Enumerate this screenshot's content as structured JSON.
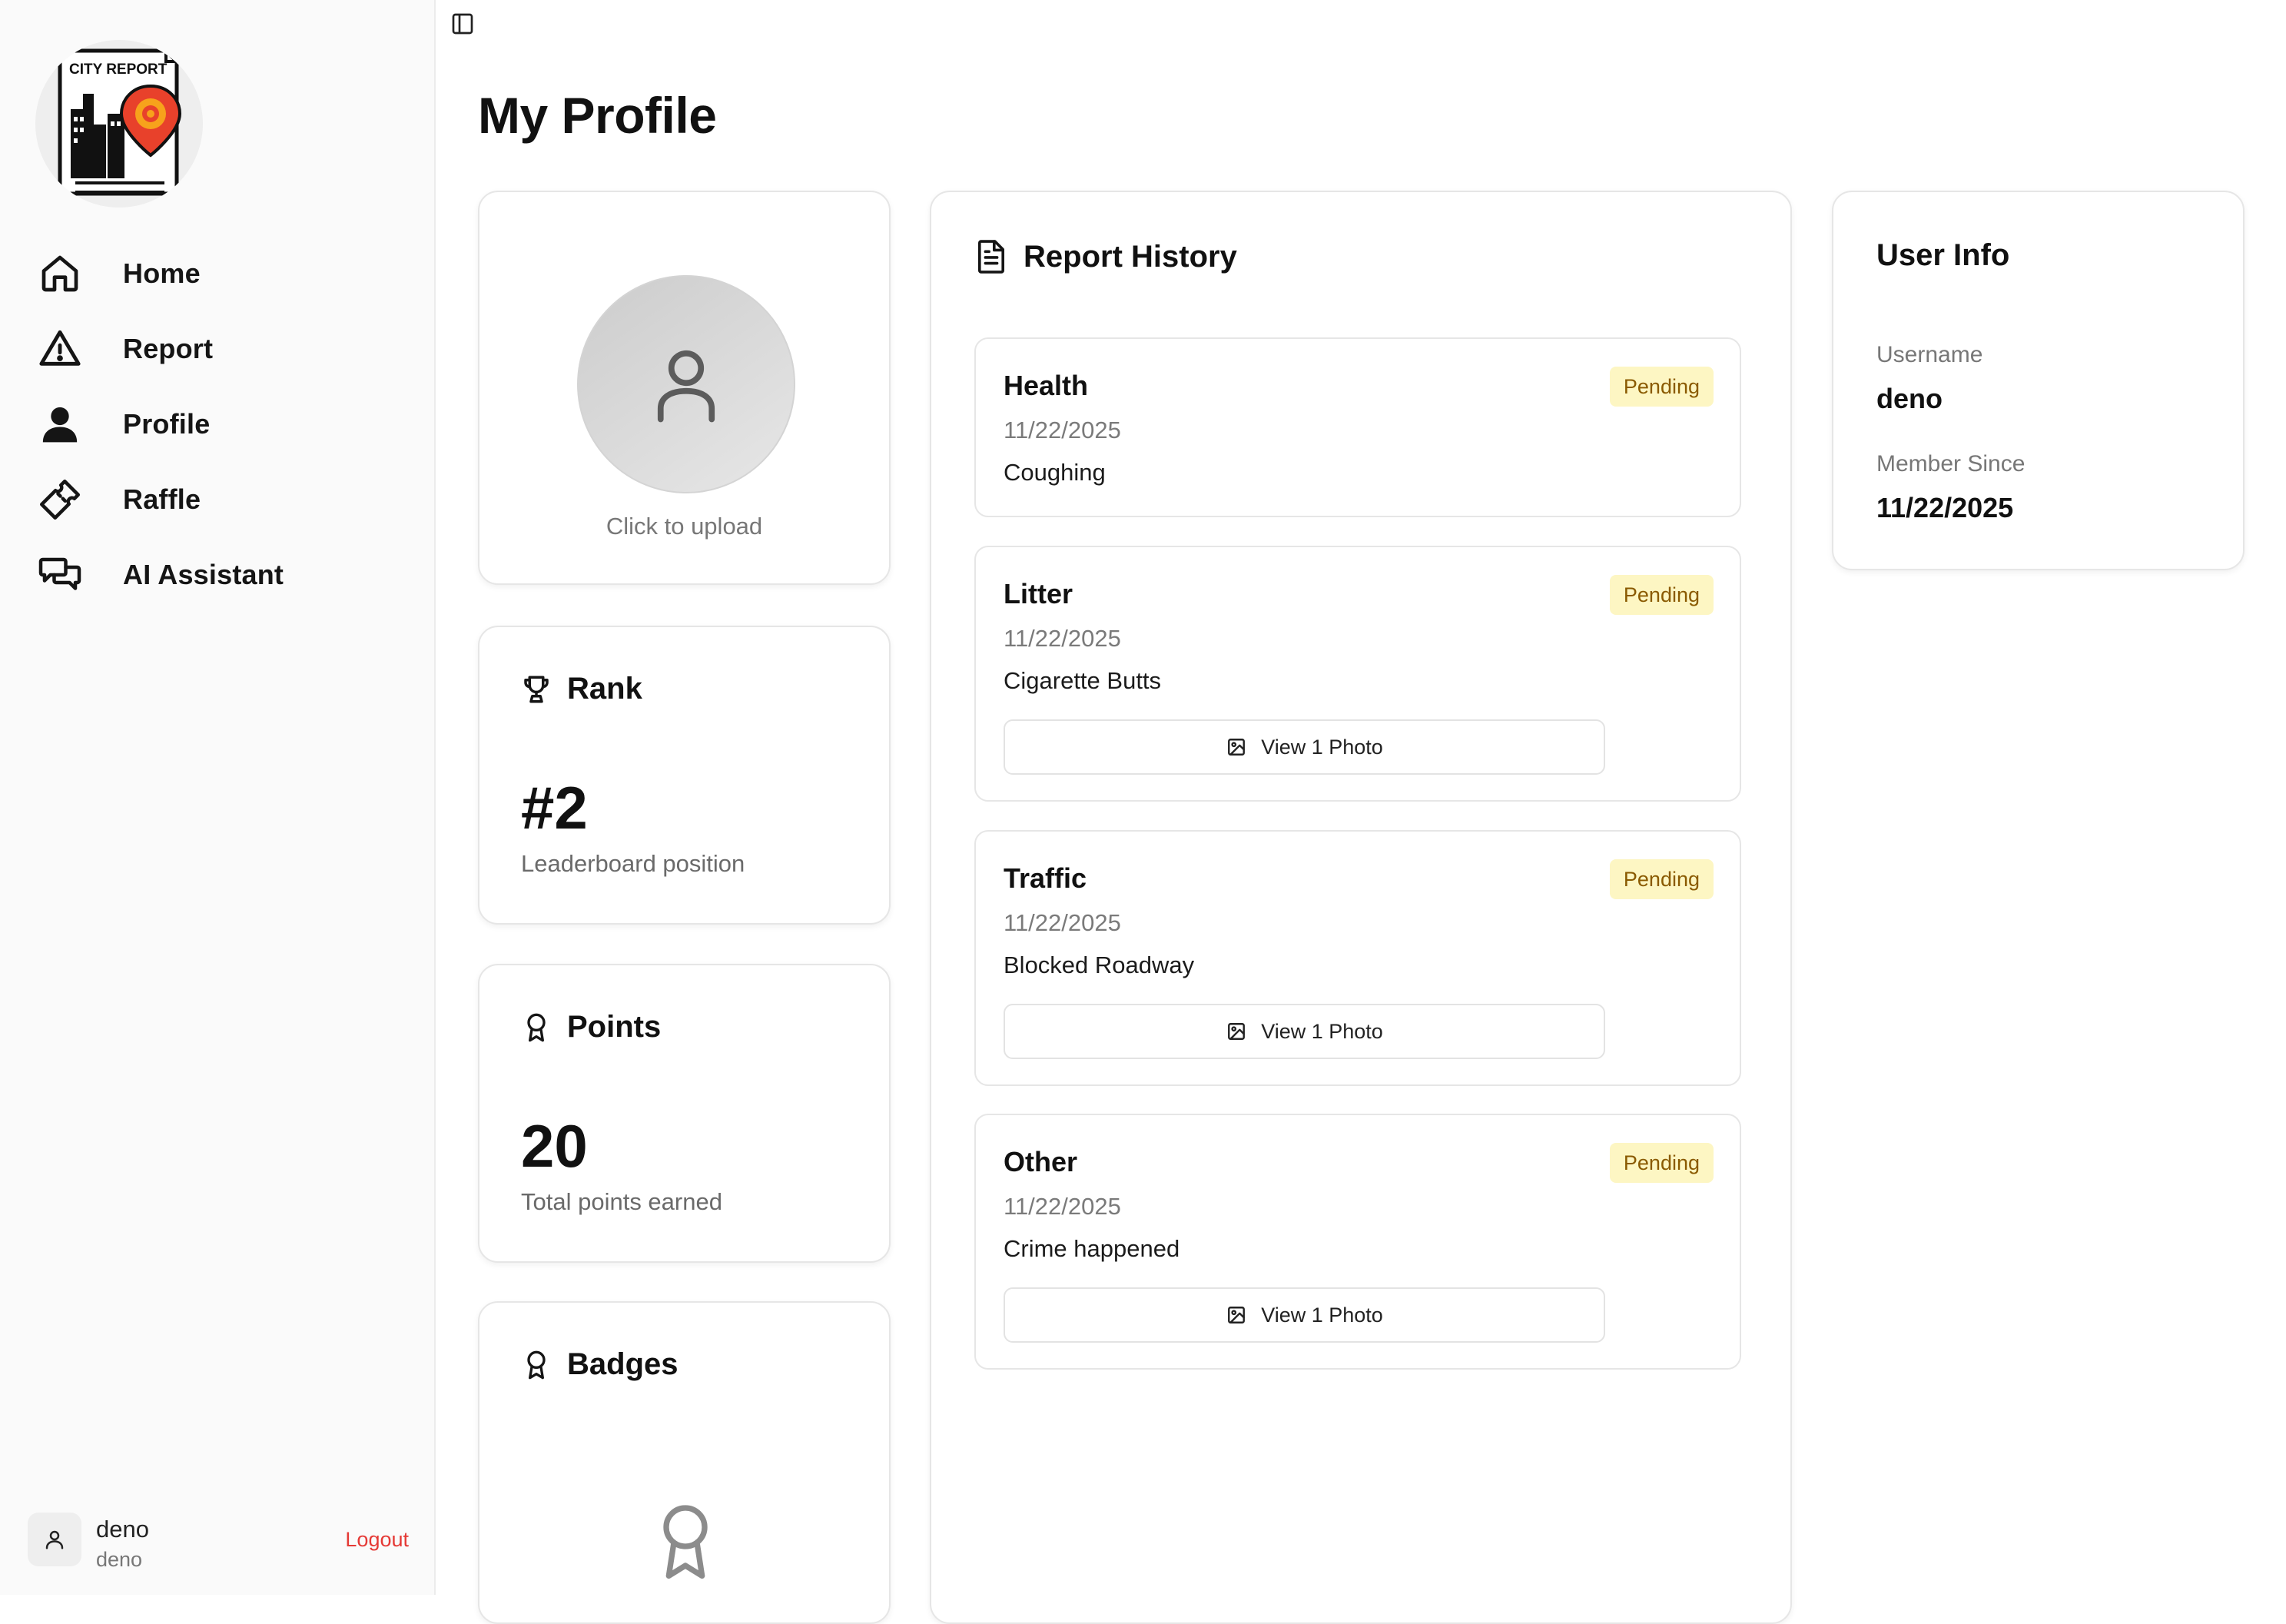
{
  "sidebar": {
    "logo_text": "CITY REPORT",
    "nav": [
      {
        "label": "Home",
        "icon": "home-icon"
      },
      {
        "label": "Report",
        "icon": "warning-triangle-icon"
      },
      {
        "label": "Profile",
        "icon": "user-icon"
      },
      {
        "label": "Raffle",
        "icon": "ticket-icon"
      },
      {
        "label": "AI Assistant",
        "icon": "chat-bubbles-icon"
      }
    ],
    "user": {
      "name": "deno",
      "username": "deno"
    },
    "logout_label": "Logout"
  },
  "header": {
    "toggle_icon": "sidebar-toggle-icon"
  },
  "page": {
    "title": "My Profile"
  },
  "avatar_card": {
    "upload_label": "Click to upload"
  },
  "rank_card": {
    "title": "Rank",
    "value": "#2",
    "subtitle": "Leaderboard position"
  },
  "points_card": {
    "title": "Points",
    "value": "20",
    "subtitle": "Total points earned"
  },
  "badges_card": {
    "title": "Badges"
  },
  "report_history": {
    "title": "Report History",
    "reports": [
      {
        "category": "Health",
        "date": "11/22/2025",
        "description": "Coughing",
        "status": "Pending",
        "photo_label": ""
      },
      {
        "category": "Litter",
        "date": "11/22/2025",
        "description": "Cigarette Butts",
        "status": "Pending",
        "photo_label": "View 1 Photo"
      },
      {
        "category": "Traffic",
        "date": "11/22/2025",
        "description": "Blocked Roadway",
        "status": "Pending",
        "photo_label": "View 1 Photo"
      },
      {
        "category": "Other",
        "date": "11/22/2025",
        "description": "Crime happened",
        "status": "Pending",
        "photo_label": "View 1 Photo"
      }
    ]
  },
  "user_info": {
    "title": "User Info",
    "username_label": "Username",
    "username": "deno",
    "member_since_label": "Member Since",
    "member_since": "11/22/2025"
  },
  "colors": {
    "pending_bg": "#fdf6c3",
    "pending_text": "#8a5a00",
    "logout": "#e53935",
    "logo_pin": "#e8412b"
  }
}
